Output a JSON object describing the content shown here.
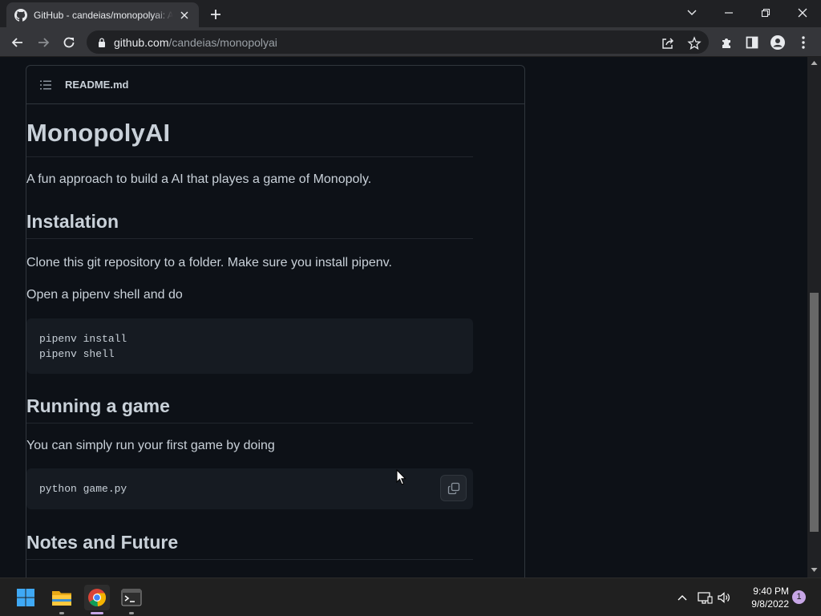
{
  "browser": {
    "tab_title": "GitHub - candeias/monopolyai: A fun approach to build a AI that playes a game of Monopoly.",
    "url_host": "github.com",
    "url_path": "/candeias/monopolyai"
  },
  "readme": {
    "file_name": "README.md",
    "title": "MonopolyAI",
    "intro": "A fun approach to build a AI that playes a game of Monopoly.",
    "installation_heading": "Instalation",
    "installation_p1": "Clone this git repository to a folder. Make sure you install pipenv.",
    "installation_p2": "Open a pipenv shell and do",
    "install_code_line1": "pipenv install",
    "install_code_line2": "pipenv shell",
    "running_heading": "Running a game",
    "running_p": "You can simply run your first game by doing",
    "running_code": "python game.py",
    "notes_heading": "Notes and Future"
  },
  "taskbar": {
    "time": "9:40 PM",
    "date": "9/8/2022",
    "notification_count": "1"
  },
  "colors": {
    "page_bg": "#0d1117",
    "text": "#c9d1d9",
    "border": "#30363d",
    "code_bg": "#161b22"
  }
}
